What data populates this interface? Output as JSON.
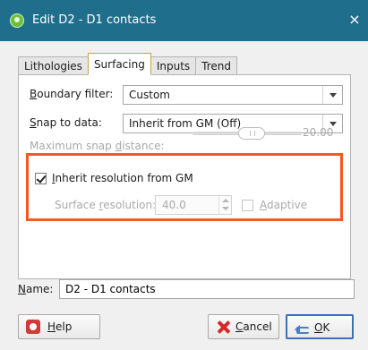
{
  "window": {
    "title": "Edit D2 - D1 contacts",
    "close_label": "×"
  },
  "tabs": [
    {
      "label": "Lithologies",
      "active": false
    },
    {
      "label": "Surfacing",
      "active": true
    },
    {
      "label": "Inputs",
      "active": false
    },
    {
      "label": "Trend",
      "active": false
    }
  ],
  "surfacing": {
    "boundary_filter": {
      "label_prefix": "B",
      "label_rest": "oundary filter:",
      "value": "Custom"
    },
    "snap_to_data": {
      "label_prefix": "S",
      "label_rest": "nap to data:",
      "value": "Inherit from GM (Off)"
    },
    "max_snap": {
      "label_pre": "Maximum snap ",
      "label_ul": "d",
      "label_post": "istance:",
      "value": "20.00",
      "level": 0.5
    },
    "inherit_resolution": {
      "label_ul": "I",
      "label_rest": "nherit resolution from GM",
      "checked": true
    },
    "surface_resolution": {
      "label_pre": "Surface ",
      "label_ul": "r",
      "label_post": "esolution:",
      "value": "40.0"
    },
    "adaptive": {
      "label_ul": "A",
      "label_rest": "daptive",
      "checked": false
    }
  },
  "name_field": {
    "label_ul": "N",
    "label_rest": "ame:",
    "value": "D2 - D1 contacts"
  },
  "buttons": {
    "help": {
      "label_ul": "H",
      "label_rest": "elp"
    },
    "cancel": {
      "label_ul": "C",
      "label_rest": "ancel"
    },
    "ok": {
      "label_ul": "O",
      "label_rest": "K"
    }
  },
  "colors": {
    "titlebar": "#1f6e8c",
    "highlight": "#f15a24"
  }
}
